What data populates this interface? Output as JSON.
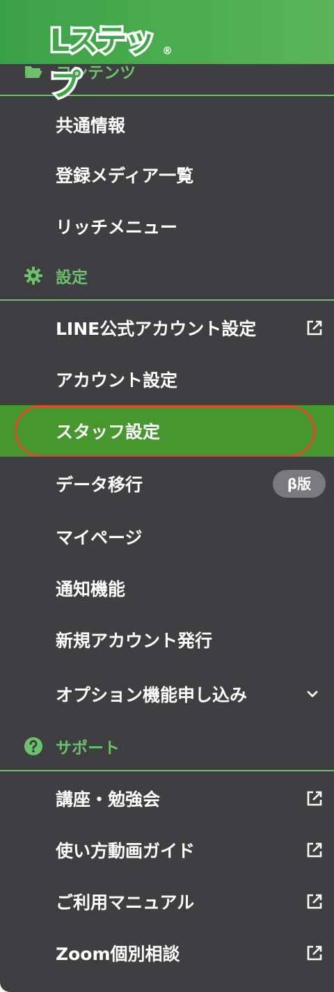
{
  "header": {
    "logo_text": "Lステップ",
    "logo_mark": "®"
  },
  "colors": {
    "header_green": "#4cae50",
    "sidebar_bg": "#3f3f42",
    "section_green": "#6cc16c",
    "active_green": "#46982e",
    "highlight_red": "#e2452f"
  },
  "sections": {
    "contents": {
      "label": "コンテンツ",
      "icon": "folder-open-icon"
    },
    "settings": {
      "label": "設定",
      "icon": "gear-icon"
    },
    "support": {
      "label": "サポート",
      "icon": "question-circle-icon"
    }
  },
  "items": {
    "common_info": "共通情報",
    "media_list": "登録メディア一覧",
    "rich_menu": "リッチメニュー",
    "line_account": "LINE公式アカウント設定",
    "account_settings": "アカウント設定",
    "staff_settings": "スタッフ設定",
    "data_migration": "データ移行",
    "data_migration_badge": "β版",
    "my_page": "マイページ",
    "notifications": "通知機能",
    "new_account": "新規アカウント発行",
    "option_apply": "オプション機能申し込み",
    "seminar": "講座・勉強会",
    "video_guide": "使い方動画ガイド",
    "manual": "ご利用マニュアル",
    "zoom": "Zoom個別相談"
  }
}
